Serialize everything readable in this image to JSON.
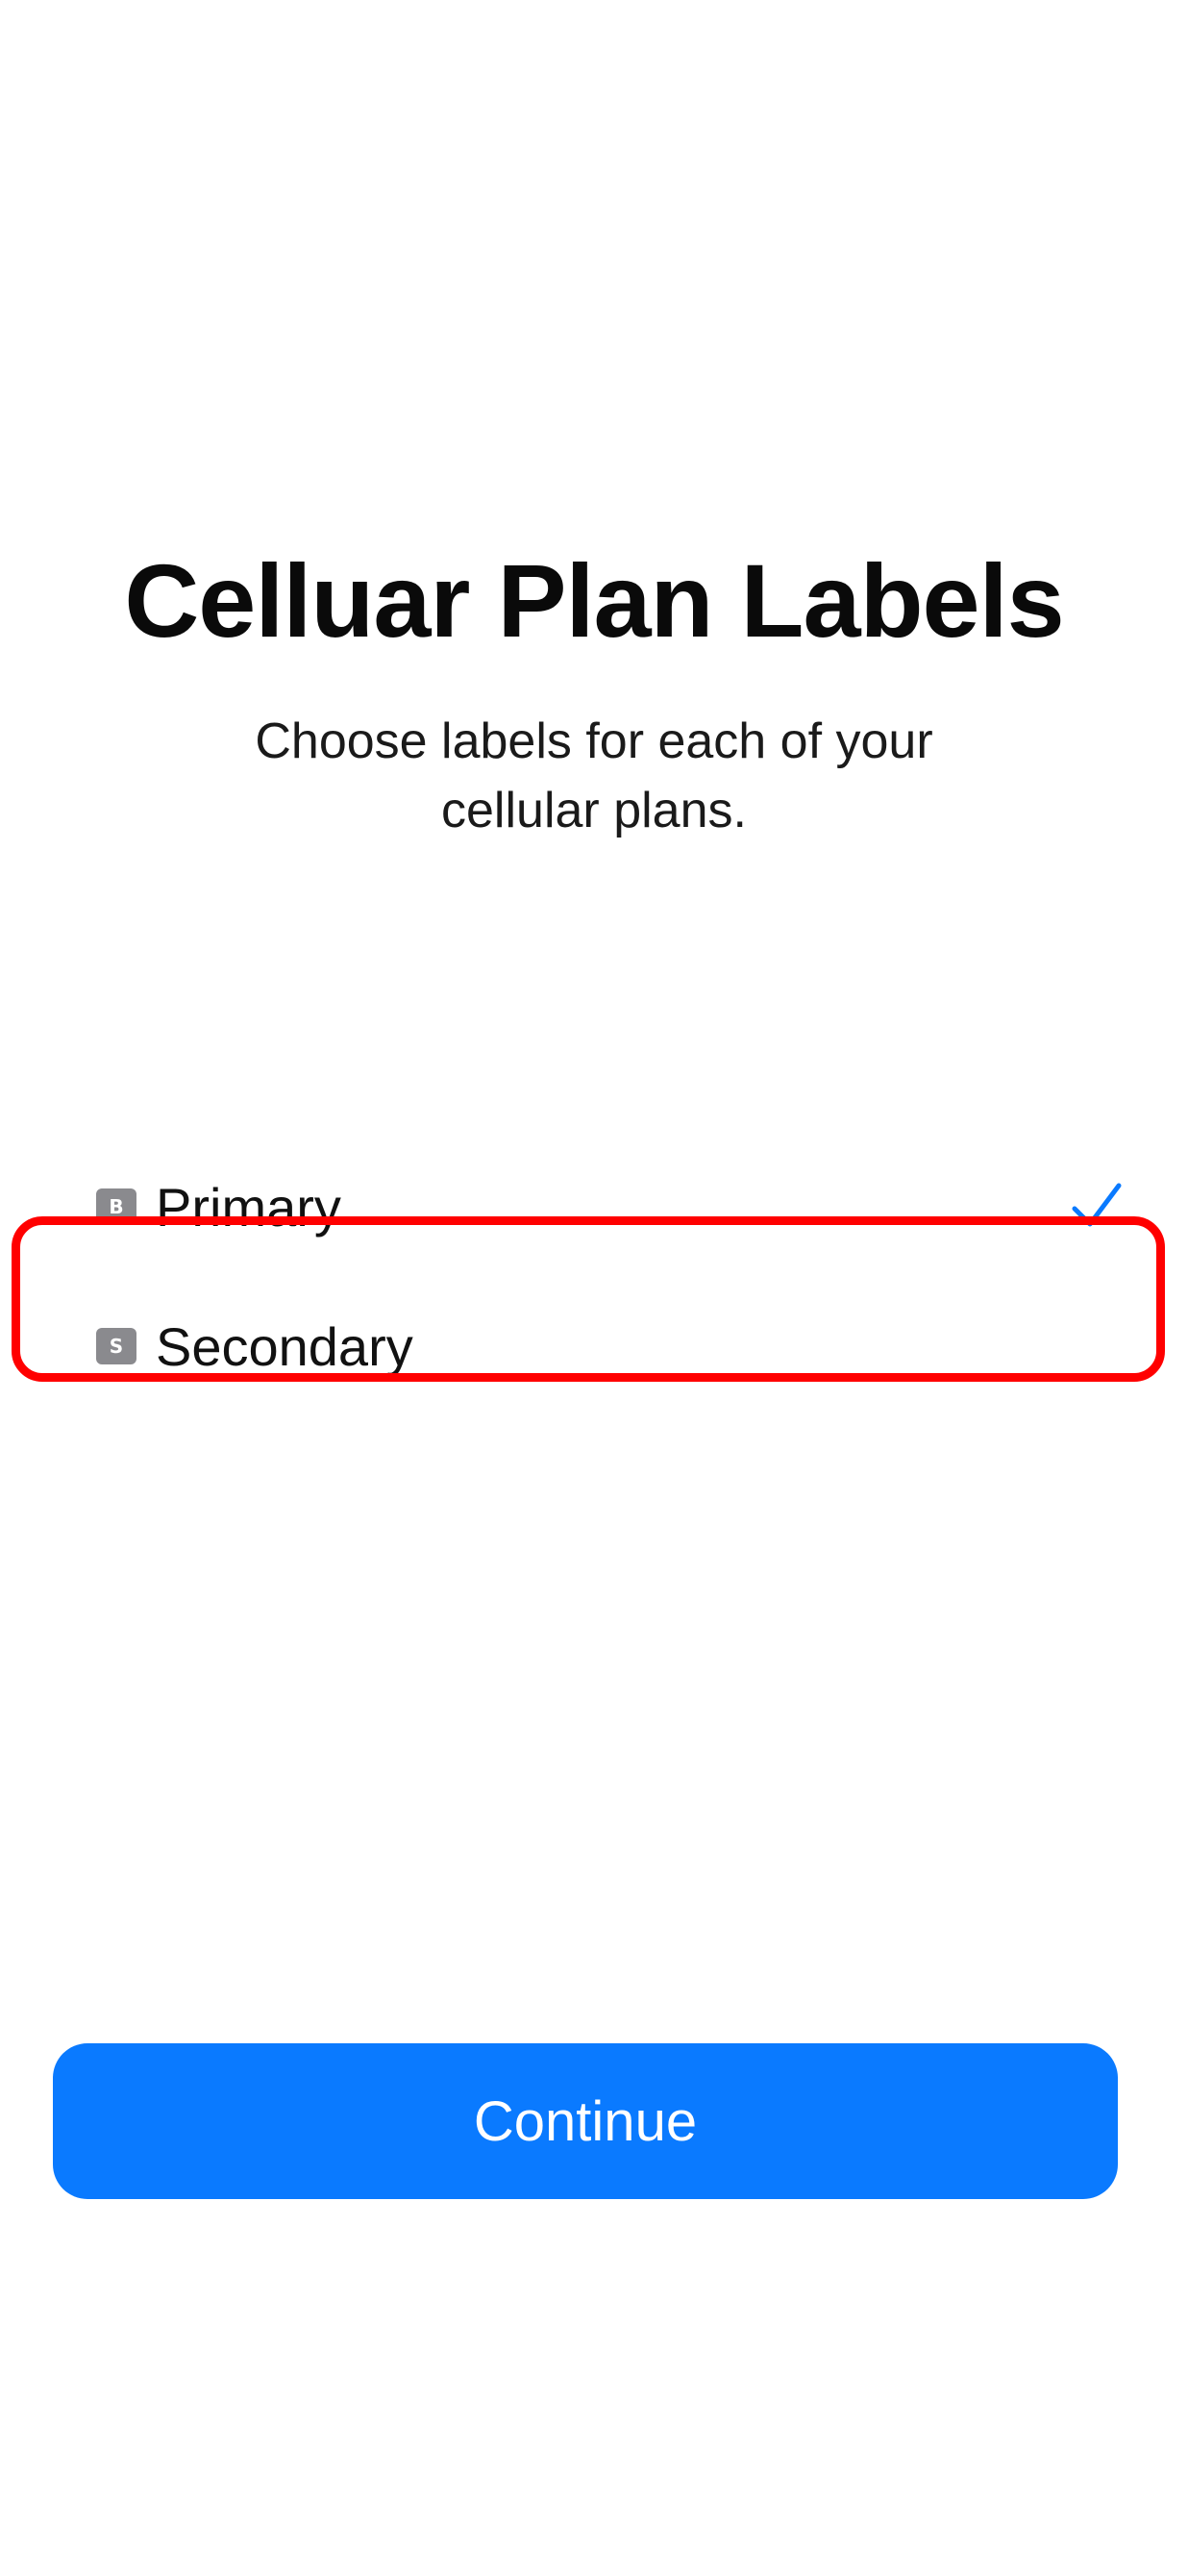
{
  "header": {
    "title": "Celluar Plan Labels",
    "subtitle": "Choose labels for each of your cellular plans."
  },
  "plans": [
    {
      "badge": "B",
      "label": "Primary",
      "selected": true
    },
    {
      "badge": "S",
      "label": "Secondary",
      "selected": false
    }
  ],
  "footer": {
    "continue_label": "Continue"
  },
  "colors": {
    "accent": "#0a7aff",
    "highlight": "#ff0000",
    "badge": "#8a8a8e"
  },
  "icons": {
    "check": "checkmark-icon"
  }
}
